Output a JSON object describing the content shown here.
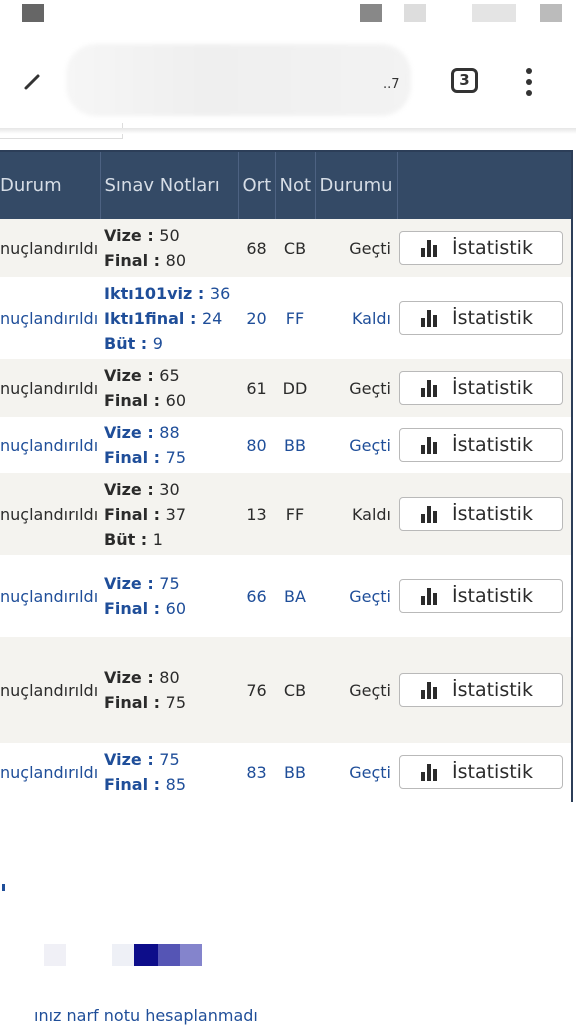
{
  "browser": {
    "url_tail": "..7",
    "tab_count": "3"
  },
  "table": {
    "headers": {
      "durum": "Durum",
      "notes": "Sınav Notları",
      "ort": "Ort",
      "not": "Not",
      "durumu": "Durumu"
    },
    "rows": [
      {
        "durum": "nuçlandırıldı",
        "notes": [
          {
            "k": "Vize",
            "v": "50"
          },
          {
            "k": "Final",
            "v": "80"
          }
        ],
        "ort": "68",
        "not": "CB",
        "durumu": "Geçti",
        "button": "İstatistik",
        "blue": false
      },
      {
        "durum": "nuçlandırıldı",
        "notes": [
          {
            "k": "Iktı101viz",
            "v": "36"
          },
          {
            "k": "Iktı1final",
            "v": "24"
          },
          {
            "k": "Büt",
            "v": "9"
          }
        ],
        "ort": "20",
        "not": "FF",
        "durumu": "Kaldı",
        "button": "İstatistik",
        "blue": true
      },
      {
        "durum": "nuçlandırıldı",
        "notes": [
          {
            "k": "Vize",
            "v": "65"
          },
          {
            "k": "Final",
            "v": "60"
          }
        ],
        "ort": "61",
        "not": "DD",
        "durumu": "Geçti",
        "button": "İstatistik",
        "blue": false
      },
      {
        "durum": "nuçlandırıldı",
        "notes": [
          {
            "k": "Vize",
            "v": "88"
          },
          {
            "k": "Final",
            "v": "75"
          }
        ],
        "ort": "80",
        "not": "BB",
        "durumu": "Geçti",
        "button": "İstatistik",
        "blue": true
      },
      {
        "durum": "nuçlandırıldı",
        "notes": [
          {
            "k": "Vize",
            "v": "30"
          },
          {
            "k": "Final",
            "v": "37"
          },
          {
            "k": "Büt",
            "v": "1"
          }
        ],
        "ort": "13",
        "not": "FF",
        "durumu": "Kaldı",
        "button": "İstatistik",
        "blue": false
      },
      {
        "durum": "nuçlandırıldı",
        "notes": [
          {
            "k": "Vize",
            "v": "75"
          },
          {
            "k": "Final",
            "v": "60"
          }
        ],
        "ort": "66",
        "not": "BA",
        "durumu": "Geçti",
        "button": "İstatistik",
        "blue": true
      },
      {
        "durum": "nuçlandırıldı",
        "notes": [
          {
            "k": "Vize",
            "v": "80"
          },
          {
            "k": "Final",
            "v": "75"
          }
        ],
        "ort": "76",
        "not": "CB",
        "durumu": "Geçti",
        "button": "İstatistik",
        "blue": false
      },
      {
        "durum": "nuçlandırıldı",
        "notes": [
          {
            "k": "Vize",
            "v": "75"
          },
          {
            "k": "Final",
            "v": "85"
          }
        ],
        "ort": "83",
        "not": "BB",
        "durumu": "Geçti",
        "button": "İstatistik",
        "blue": true
      }
    ]
  },
  "footer": {
    "note": "ınız narf notu hesaplanmadı"
  },
  "colors": {
    "header_bg": "#344a66",
    "link_blue": "#1f4e99",
    "row_alt": "#f4f3ef"
  }
}
